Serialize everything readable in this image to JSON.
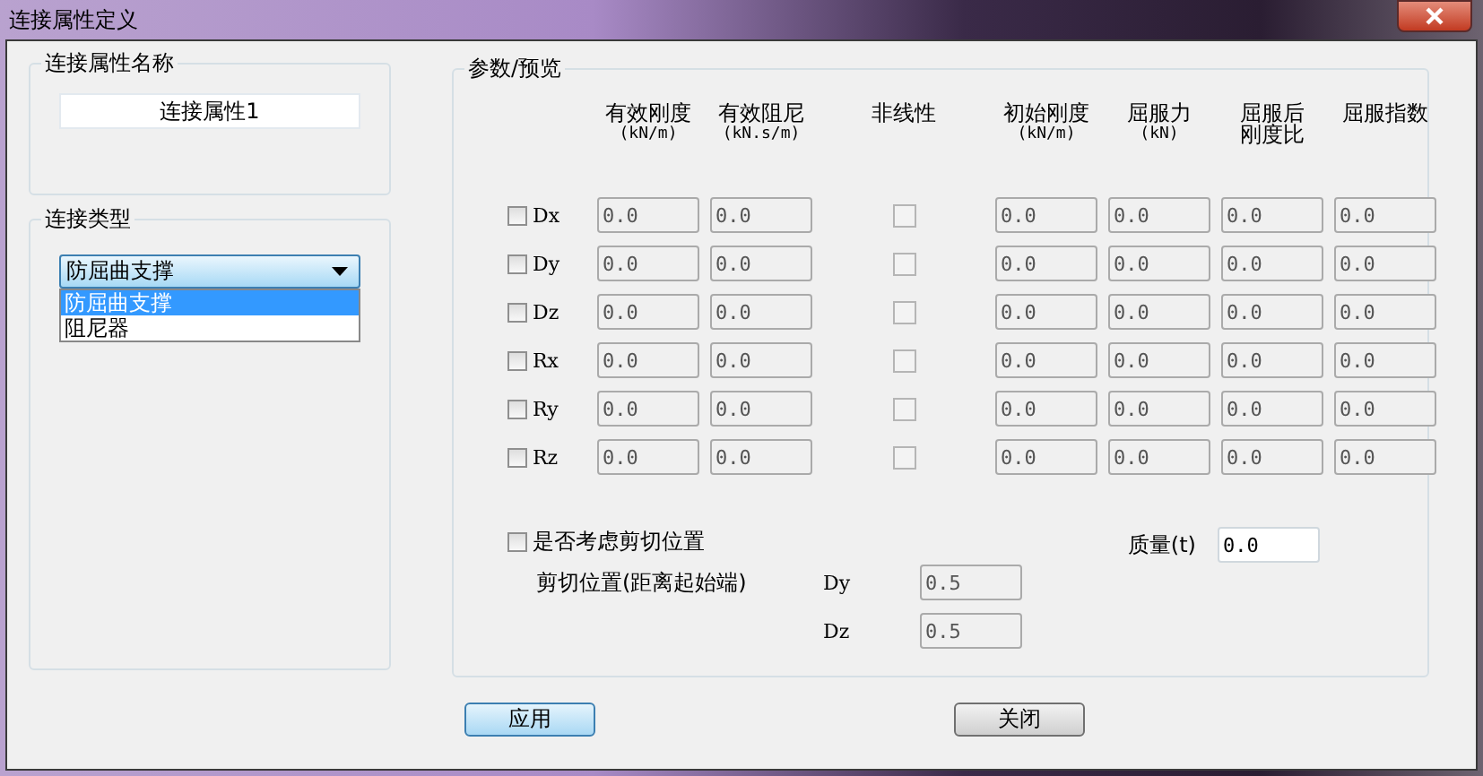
{
  "window": {
    "title": "连接属性定义"
  },
  "name_group": {
    "label": "连接属性名称",
    "value": "连接属性1"
  },
  "type_group": {
    "label": "连接类型",
    "dropdown": {
      "value": "防屈曲支撑",
      "expanded": true,
      "options": [
        {
          "label": "防屈曲支撑",
          "selected": true
        },
        {
          "label": "阻尼器",
          "selected": false
        }
      ]
    }
  },
  "params": {
    "label": "参数/预览",
    "columns": [
      {
        "kind": "field",
        "lines": [
          "有效刚度",
          "(kN/m)"
        ]
      },
      {
        "kind": "field",
        "lines": [
          "有效阻尼",
          "(kN.s/m)"
        ]
      },
      {
        "kind": "checkbox",
        "lines": [
          "非线性"
        ]
      },
      {
        "kind": "field",
        "lines": [
          "初始刚度",
          "(kN/m)"
        ]
      },
      {
        "kind": "field",
        "lines": [
          "屈服力",
          "(kN)"
        ]
      },
      {
        "kind": "field",
        "lines": [
          "屈服后",
          "刚度比"
        ]
      },
      {
        "kind": "field",
        "lines": [
          "屈服指数"
        ]
      }
    ],
    "rows": [
      {
        "label": "Dx",
        "checked": false,
        "disabled": true,
        "nonlinear": false,
        "values": [
          "0.0",
          "0.0",
          "0.0",
          "0.0",
          "0.0",
          "0.0"
        ]
      },
      {
        "label": "Dy",
        "checked": false,
        "disabled": true,
        "nonlinear": false,
        "values": [
          "0.0",
          "0.0",
          "0.0",
          "0.0",
          "0.0",
          "0.0"
        ]
      },
      {
        "label": "Dz",
        "checked": false,
        "disabled": true,
        "nonlinear": false,
        "values": [
          "0.0",
          "0.0",
          "0.0",
          "0.0",
          "0.0",
          "0.0"
        ]
      },
      {
        "label": "Rx",
        "checked": false,
        "disabled": true,
        "nonlinear": false,
        "values": [
          "0.0",
          "0.0",
          "0.0",
          "0.0",
          "0.0",
          "0.0"
        ]
      },
      {
        "label": "Ry",
        "checked": false,
        "disabled": true,
        "nonlinear": false,
        "values": [
          "0.0",
          "0.0",
          "0.0",
          "0.0",
          "0.0",
          "0.0"
        ]
      },
      {
        "label": "Rz",
        "checked": false,
        "disabled": true,
        "nonlinear": false,
        "values": [
          "0.0",
          "0.0",
          "0.0",
          "0.0",
          "0.0",
          "0.0"
        ]
      }
    ],
    "shear": {
      "label": "是否考虑剪切位置",
      "checked": false,
      "position_label": "剪切位置(距离起始端)",
      "positions": [
        {
          "label": "Dy",
          "value": "0.5",
          "disabled": true
        },
        {
          "label": "Dz",
          "value": "0.5",
          "disabled": true
        }
      ]
    },
    "mass": {
      "label": "质量(t)",
      "value": "0.0"
    }
  },
  "buttons": [
    {
      "label": "应用",
      "default": true
    },
    {
      "label": "关闭",
      "default": false
    }
  ]
}
